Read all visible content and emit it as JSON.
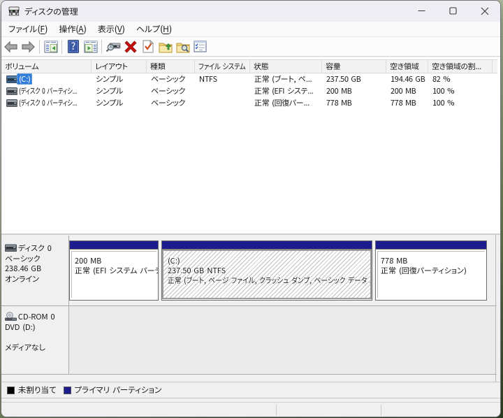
{
  "window": {
    "title": "ディスクの管理",
    "caption_buttons": [
      "minimize",
      "maximize",
      "close"
    ]
  },
  "menu": {
    "items": [
      {
        "label": "ファイル",
        "accel": "F"
      },
      {
        "label": "操作",
        "accel": "A"
      },
      {
        "label": "表示",
        "accel": "V"
      },
      {
        "label": "ヘルプ",
        "accel": "H"
      }
    ]
  },
  "toolbar": {
    "icons": [
      "back",
      "forward",
      "show-console-tree",
      "help",
      "show-action-pane",
      "disk-rescan",
      "delete-volume",
      "mark-partition-active",
      "open",
      "explore",
      "properties"
    ]
  },
  "volume_list": {
    "columns": {
      "volume": "ボリューム",
      "layout": "レイアウト",
      "type": "種類",
      "fs": "ファイル システム",
      "status": "状態",
      "capacity": "容量",
      "free": "空き領域",
      "pct": "空き領域の割..."
    },
    "rows": [
      {
        "volume": "(C:)",
        "layout": "シンプル",
        "type": "ベーシック",
        "fs": "NTFS",
        "status": "正常 (ブート, ペ...",
        "capacity": "237.50 GB",
        "free": "194.46 GB",
        "pct": "82 %",
        "selected": true
      },
      {
        "volume": "(ディスク 0 パーティシ...",
        "layout": "シンプル",
        "type": "ベーシック",
        "fs": "",
        "status": "正常 (EFI システ...",
        "capacity": "200 MB",
        "free": "200 MB",
        "pct": "100 %",
        "selected": false
      },
      {
        "volume": "(ディスク 0 パーティシ...",
        "layout": "シンプル",
        "type": "ベーシック",
        "fs": "",
        "status": "正常 (回復パー...",
        "capacity": "778 MB",
        "free": "778 MB",
        "pct": "100 %",
        "selected": false
      }
    ]
  },
  "disks": [
    {
      "name": "ディスク 0",
      "kind": "ベーシック",
      "size": "238.46 GB",
      "state": "オンライン",
      "partitions": [
        {
          "name": "",
          "size_fs": "200 MB",
          "status": "正常 (EFI システム パーティション)",
          "selected": false
        },
        {
          "name": "(C:)",
          "size_fs": "237.50 GB NTFS",
          "status": "正常 (ブート, ページ ファイル, クラッシュ ダンプ, ベーシック データ パーティション)",
          "selected": true
        },
        {
          "name": "",
          "size_fs": "778 MB",
          "status": "正常 (回復パーティション)",
          "selected": false
        }
      ]
    },
    {
      "name": "CD-ROM 0",
      "kind": "DVD (D:)",
      "size": "",
      "state": "メディアなし",
      "partitions": []
    }
  ],
  "legend": {
    "items": [
      {
        "label": "未割り当て",
        "color": "#000000"
      },
      {
        "label": "プライマリ パーティション",
        "color": "#1c1c8e"
      }
    ]
  },
  "colors": {
    "selection_blue": "#2f7bd8",
    "partition_band_navy": "#1c1c8e"
  }
}
